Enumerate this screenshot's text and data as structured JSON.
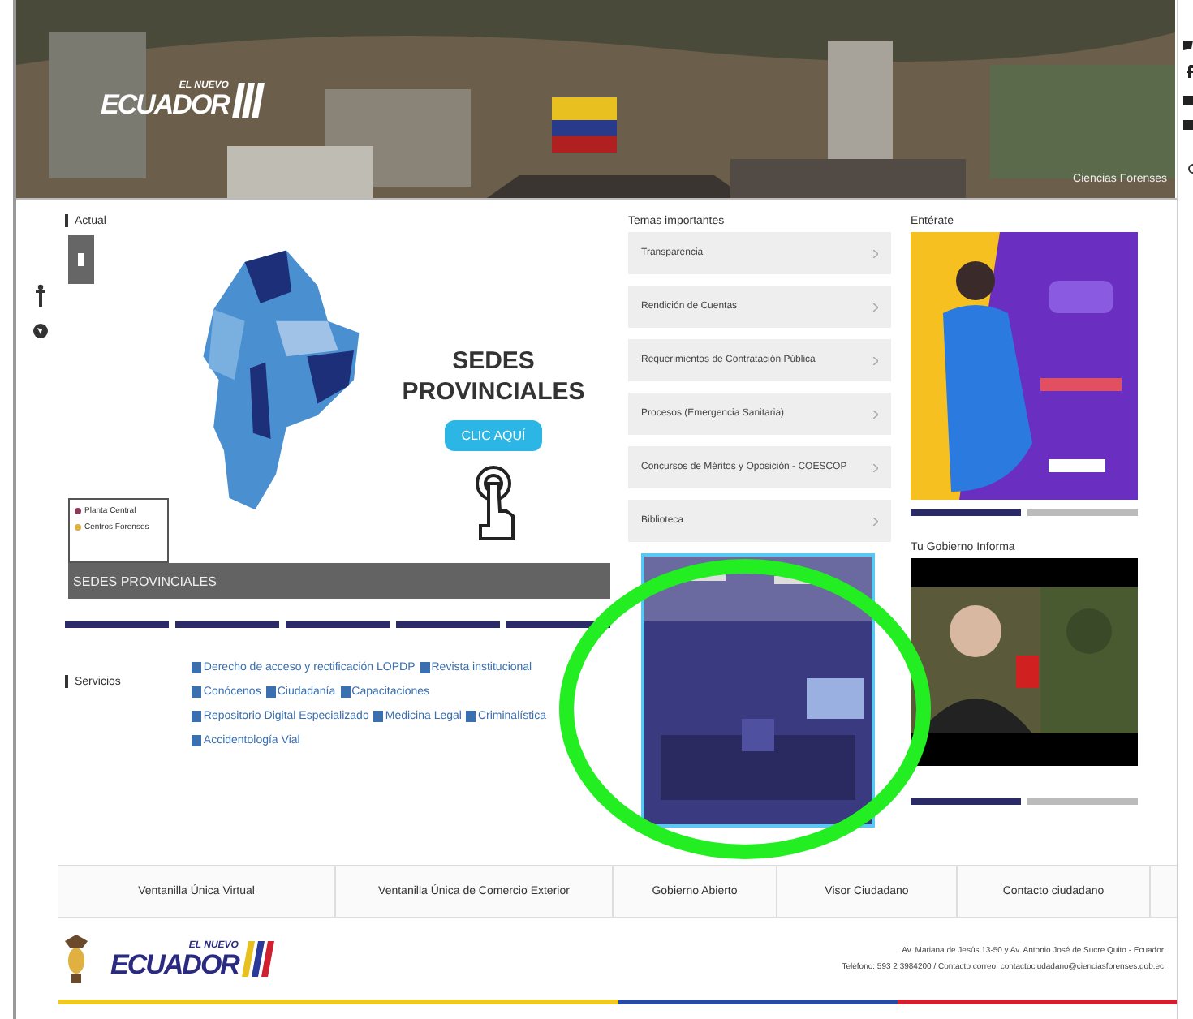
{
  "header": {
    "logo_small": "EL NUEVO",
    "logo": "ECUADOR",
    "caption": "Ciencias Forenses"
  },
  "actual": {
    "title": "Actual",
    "banner": {
      "heading": "SEDES PROVINCIALES",
      "button": "CLIC AQUÍ",
      "legend": [
        "Planta Central",
        "Centros Forenses"
      ],
      "caption": "SEDES PROVINCIALES"
    }
  },
  "servicios": {
    "title": "Servicios",
    "links": [
      "Derecho de acceso y rectificación LOPDP",
      "Revista institucional",
      "Conócenos",
      "Ciudadanía",
      "Capacitaciones",
      "Repositorio Digital Especializado",
      "Medicina Legal",
      "Criminalística",
      "Accidentología Vial"
    ]
  },
  "temas": {
    "title": "Temas importantes",
    "items": [
      "Transparencia",
      "Rendición de Cuentas",
      "Requerimientos de Contratación Pública",
      "Procesos (Emergencia Sanitaria)",
      "Concursos de Méritos y Oposición - COESCOP",
      "Biblioteca"
    ]
  },
  "enterate": {
    "title": "Entérate",
    "indicators": [
      {
        "selected": true
      },
      {
        "selected": false
      }
    ]
  },
  "gobierno": {
    "title": "Tu Gobierno Informa",
    "indicators": [
      {
        "selected": true
      },
      {
        "selected": false
      }
    ]
  },
  "footer_nav": [
    "Ventanilla Única Virtual",
    "Ventanilla Única de Comercio Exterior",
    "Gobierno Abierto",
    "Visor Ciudadano",
    "Contacto ciudadano"
  ],
  "footer": {
    "logo_small": "EL NUEVO",
    "logo": "ECUADOR",
    "address": "Av. Mariana de Jesús 13-50 y Av. Antonio José de Sucre Quito - Ecuador",
    "contact": "Teléfono: 593 2 3984200 / Contacto correo: contactociudadano@cienciasforenses.gob.ec"
  }
}
